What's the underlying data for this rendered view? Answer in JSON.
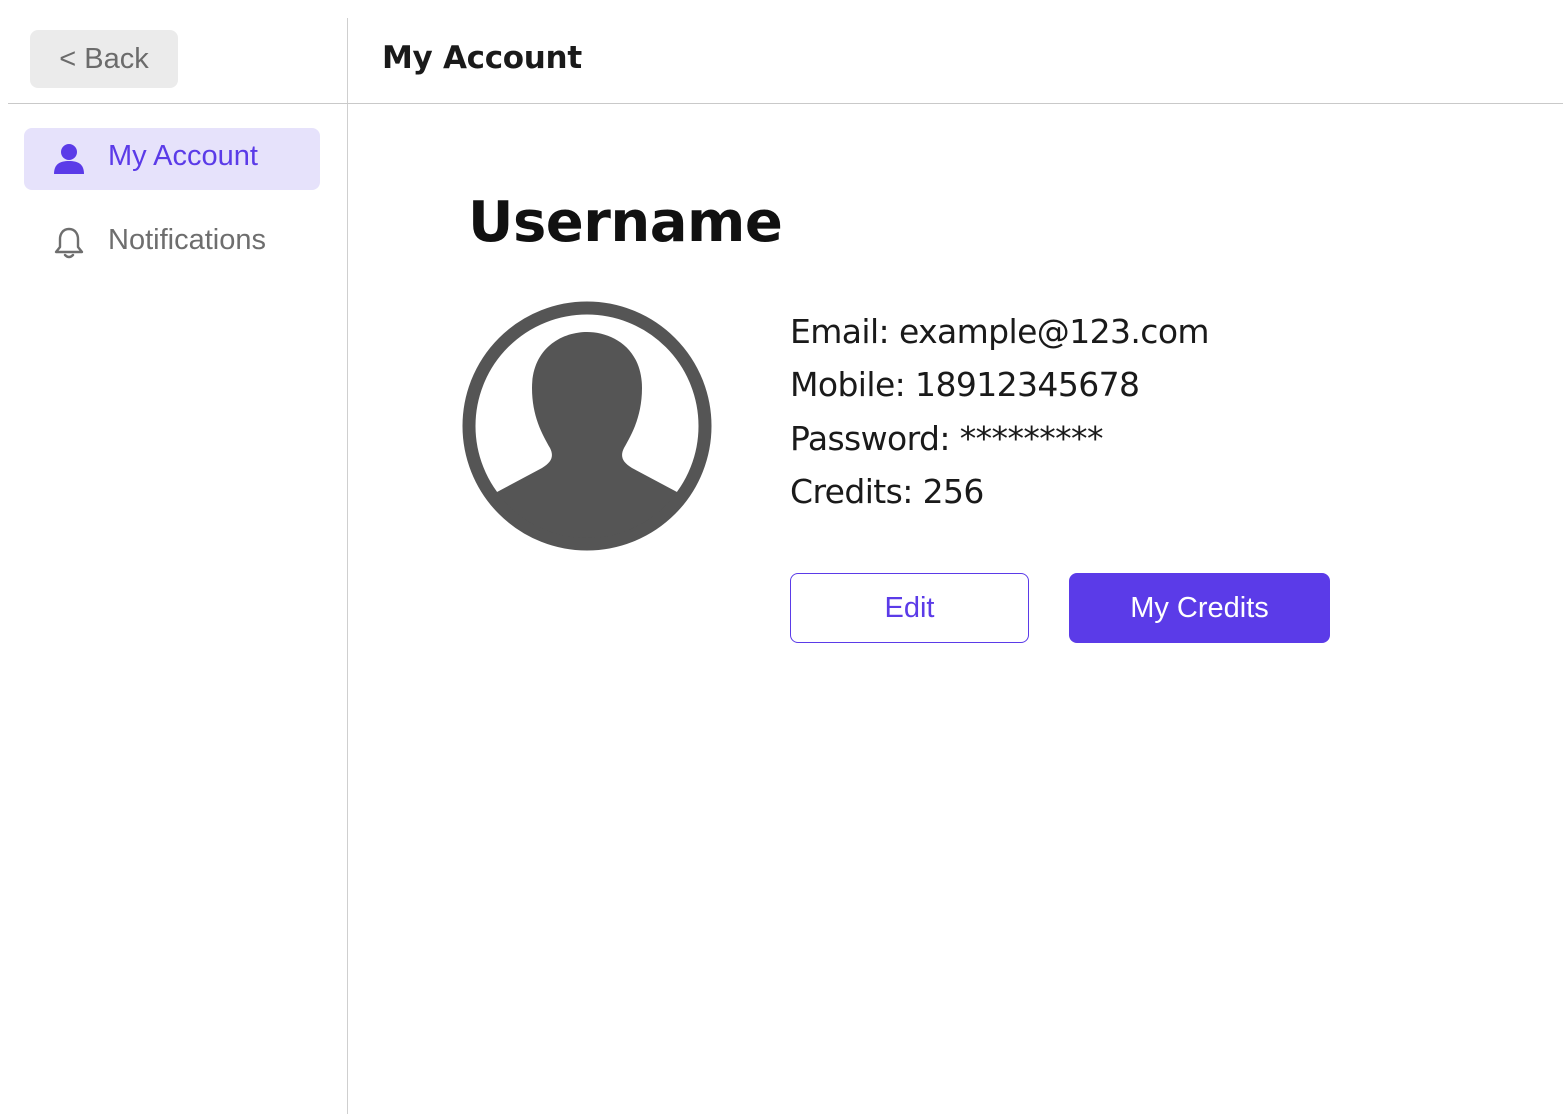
{
  "header": {
    "back_label": "< Back",
    "title": "My Account"
  },
  "sidebar": {
    "items": [
      {
        "label": "My Account",
        "icon": "user-icon",
        "active": true
      },
      {
        "label": "Notifications",
        "icon": "bell-icon",
        "active": false
      }
    ]
  },
  "profile": {
    "username": "Username",
    "avatar_icon": "avatar-placeholder-icon",
    "fields": [
      {
        "text": "Email: example@123.com"
      },
      {
        "text": "Mobile: 18912345678"
      },
      {
        "text": "Password: *********"
      },
      {
        "text": "Credits: 256"
      }
    ],
    "edit_label": "Edit",
    "credits_label": "My Credits"
  },
  "colors": {
    "accent": "#5b3be8",
    "active_nav_bg": "#e6e2fb",
    "avatar_gray": "#555555"
  }
}
